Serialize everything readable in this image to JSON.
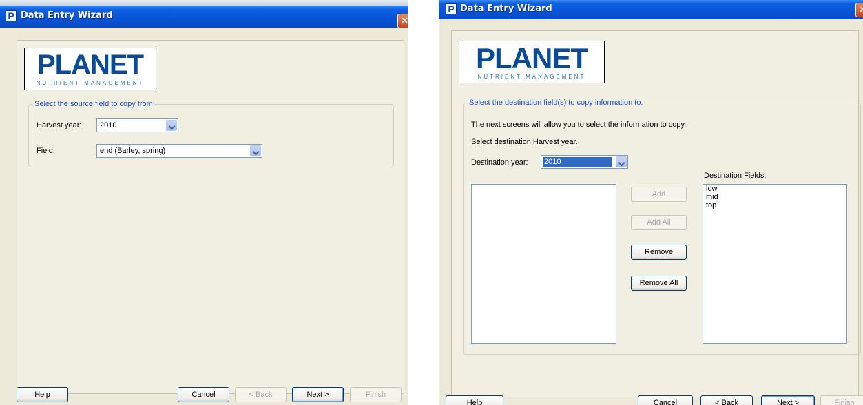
{
  "left_window": {
    "title": "Data Entry Wizard",
    "logo": {
      "word": "PLANET",
      "sub": "NUTRIENT MANAGEMENT"
    },
    "group_legend": "Select the source field to copy from",
    "harvest_year_label": "Harvest year:",
    "harvest_year_value": "2010",
    "field_label": "Field:",
    "field_value": "end (Barley, spring)",
    "buttons": {
      "help": "Help",
      "cancel": "Cancel",
      "back": "< Back",
      "next": "Next >",
      "finish": "Finish"
    }
  },
  "right_window": {
    "title": "Data Entry Wizard",
    "logo": {
      "word": "PLANET",
      "sub": "NUTRIENT MANAGEMENT"
    },
    "group_legend": "Select the destination field(s) to copy information to.",
    "info_text": "The next screens will allow you to select the information to copy.",
    "select_year_text": "Select destination Harvest year.",
    "destination_year_label": "Destination year:",
    "destination_year_value": "2010",
    "destination_fields_label": "Destination Fields:",
    "source_list_items": [],
    "destination_fields": [
      "low",
      "mid",
      "top"
    ],
    "middle_buttons": {
      "add": "Add",
      "add_all": "Add All",
      "remove": "Remove",
      "remove_all": "Remove All"
    },
    "buttons": {
      "help": "Help",
      "cancel": "Cancel",
      "back": "< Back",
      "next": "Next >",
      "finish": "Finish"
    }
  },
  "colors": {
    "titlebar": "#0854d8",
    "legend": "#1f4ecb",
    "logo": "#0a4a96"
  },
  "icons": [
    "app-icon",
    "close-icon",
    "dropdown-arrow-icon"
  ]
}
